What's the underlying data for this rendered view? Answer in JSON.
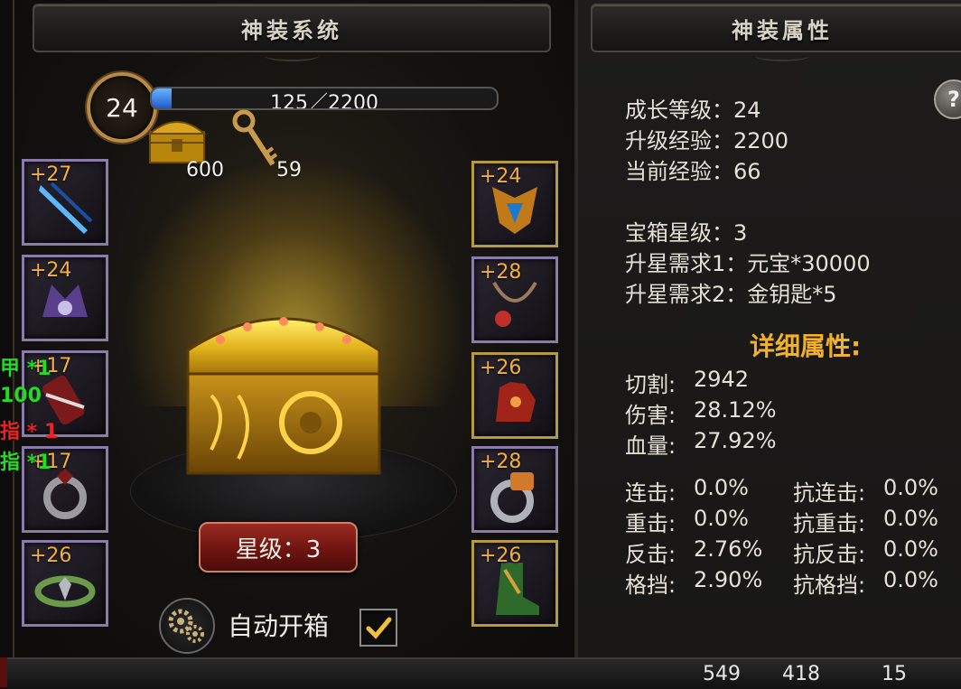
{
  "left_panel": {
    "title": "神装系统",
    "level": "24",
    "exp": {
      "text": "125／2200",
      "progress": 0.057
    },
    "resources": [
      {
        "icon": "treasure-chest-icon",
        "count": "600"
      },
      {
        "icon": "key-icon",
        "count": "59"
      }
    ],
    "left_slots": [
      "+27",
      "+24",
      "+17",
      "+17",
      "+26"
    ],
    "right_slots": [
      "+24",
      "+28",
      "+26",
      "+28",
      "+26"
    ],
    "star_button": "星级：3",
    "auto_open_label": "自动开箱",
    "auto_open_checked": true,
    "side_notes": [
      "甲 *1",
      "100",
      "指 * 1",
      "指 *1"
    ]
  },
  "right_panel": {
    "title": "神装属性",
    "help": "?",
    "growth_level": "成长等级：24",
    "upgrade_exp": "升级经验：2200",
    "current_exp": "当前经验：66",
    "chest_star": "宝箱星级：3",
    "star_req1": "升星需求1：元宝*30000",
    "star_req2": "升星需求2：金钥匙*5",
    "detail_title": "详细属性:",
    "detail_stats": [
      {
        "label": "切割:",
        "value": "2942"
      },
      {
        "label": "伤害:",
        "value": "28.12%"
      },
      {
        "label": "血量:",
        "value": "27.92%"
      }
    ],
    "combat_stats": [
      {
        "left_label": "连击:",
        "left_value": "0.0%",
        "right_label": "抗连击:",
        "right_value": "0.0%"
      },
      {
        "left_label": "重击:",
        "left_value": "0.0%",
        "right_label": "抗重击:",
        "right_value": "0.0%"
      },
      {
        "left_label": "反击:",
        "left_value": "2.76%",
        "right_label": "抗反击:",
        "right_value": "0.0%"
      },
      {
        "left_label": "格挡:",
        "left_value": "2.90%",
        "right_label": "抗格挡:",
        "right_value": "0.0%"
      }
    ]
  },
  "bottom_bar": {
    "numbers": [
      "549",
      "418",
      "15"
    ]
  },
  "colors": {
    "accent_gold": "#f2b128",
    "plus_orange": "#f5b03c",
    "note_green": "#22dd22",
    "note_red": "#ee2222"
  }
}
